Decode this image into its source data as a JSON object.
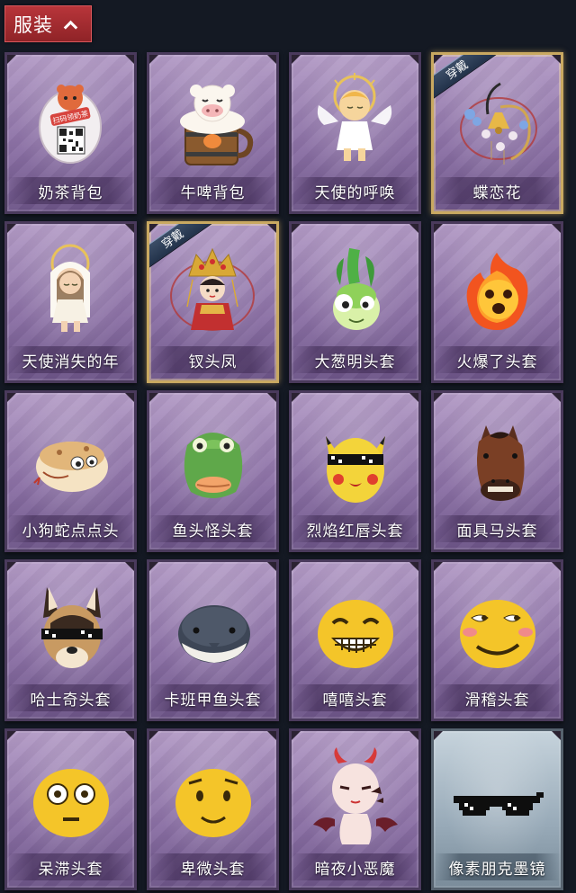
{
  "header": {
    "title": "服装"
  },
  "items": [
    {
      "name": "奶茶背包",
      "icon": "milk-tea-backpack-icon",
      "equipped": false,
      "ribbon": ""
    },
    {
      "name": "牛啤背包",
      "icon": "cow-beer-backpack-icon",
      "equipped": false,
      "ribbon": ""
    },
    {
      "name": "天使的呼唤",
      "icon": "angel-call-icon",
      "equipped": false,
      "ribbon": ""
    },
    {
      "name": "蝶恋花",
      "icon": "butterfly-flower-icon",
      "equipped": true,
      "ribbon": "穿戴"
    },
    {
      "name": "天使消失的年",
      "icon": "vanished-angel-icon",
      "equipped": false,
      "ribbon": ""
    },
    {
      "name": "钗头凤",
      "icon": "phoenix-hairpin-icon",
      "equipped": true,
      "ribbon": "穿戴"
    },
    {
      "name": "大葱明头套",
      "icon": "scallion-head-icon",
      "equipped": false,
      "ribbon": ""
    },
    {
      "name": "火爆了头套",
      "icon": "fire-head-icon",
      "equipped": false,
      "ribbon": ""
    },
    {
      "name": "小狗蛇点点头",
      "icon": "dog-snake-head-icon",
      "equipped": false,
      "ribbon": ""
    },
    {
      "name": "鱼头怪头套",
      "icon": "fish-head-icon",
      "equipped": false,
      "ribbon": ""
    },
    {
      "name": "烈焰红唇头套",
      "icon": "red-lips-head-icon",
      "equipped": false,
      "ribbon": ""
    },
    {
      "name": "面具马头套",
      "icon": "horse-mask-icon",
      "equipped": false,
      "ribbon": ""
    },
    {
      "name": "哈士奇头套",
      "icon": "husky-head-icon",
      "equipped": false,
      "ribbon": ""
    },
    {
      "name": "卡班甲鱼头套",
      "icon": "turtle-head-icon",
      "equipped": false,
      "ribbon": ""
    },
    {
      "name": "嘻嘻头套",
      "icon": "grin-emoji-head-icon",
      "equipped": false,
      "ribbon": ""
    },
    {
      "name": "滑稽头套",
      "icon": "smirk-emoji-head-icon",
      "equipped": false,
      "ribbon": ""
    },
    {
      "name": "呆滞头套",
      "icon": "dazed-emoji-head-icon",
      "equipped": false,
      "ribbon": ""
    },
    {
      "name": "卑微头套",
      "icon": "humble-emoji-head-icon",
      "equipped": false,
      "ribbon": ""
    },
    {
      "name": "暗夜小恶魔",
      "icon": "little-devil-icon",
      "equipped": false,
      "ribbon": ""
    },
    {
      "name": "像素朋克墨镜",
      "icon": "pixel-sunglasses-icon",
      "equipped": false,
      "ribbon": ""
    }
  ],
  "qr_badge_text": "扫码领奶茶",
  "colors": {
    "background": "#141923",
    "header": "#a32c30",
    "card_purple": "#8a6fa4",
    "card_blue": "#98aab8",
    "equipped_border": "#c9a961",
    "ribbon": "#2b3d56"
  }
}
